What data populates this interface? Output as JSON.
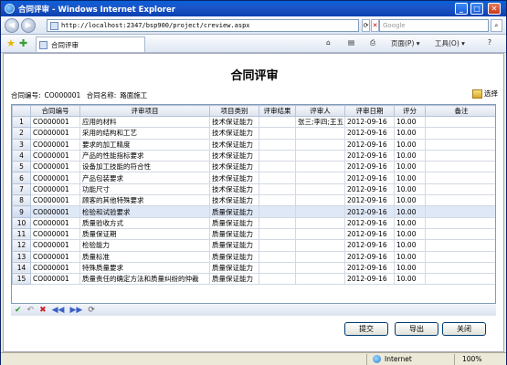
{
  "window": {
    "title": "合同评审 - Windows Internet Explorer",
    "minimize": "_",
    "maximize": "□",
    "close": "✕"
  },
  "browser": {
    "back": "◀",
    "forward": "▶",
    "url": "http://localhost:2347/bsp900/project/creview.aspx",
    "refresh": "⟳",
    "stop": "✕",
    "search_placeholder": "Google",
    "tab_title": "合同评审",
    "home": "⌂",
    "feeds": "▤",
    "print": "⎙",
    "page_menu": "页面(P) ▾",
    "tools_menu": "工具(O) ▾",
    "help": "?"
  },
  "page": {
    "title": "合同评审",
    "contract_no_label": "合同编号:",
    "contract_no": "CO000001",
    "contract_name_label": "合同名称:",
    "contract_name": "路面施工",
    "select_label": "选择"
  },
  "grid": {
    "columns": [
      "",
      "合同编号",
      "评审项目",
      "项目类别",
      "评审结果",
      "评审人",
      "评审日期",
      "评分",
      "备注"
    ],
    "rows": [
      {
        "n": "1",
        "no": "CO000001",
        "item": "应用的材料",
        "cat": "技术保证能力",
        "result": "",
        "reviewer": "张三;李四;王五",
        "date": "2012-09-16",
        "score": "10.00",
        "note": ""
      },
      {
        "n": "2",
        "no": "CO000001",
        "item": "采用的结构和工艺",
        "cat": "技术保证能力",
        "result": "",
        "reviewer": "",
        "date": "2012-09-16",
        "score": "10.00",
        "note": ""
      },
      {
        "n": "3",
        "no": "CO000001",
        "item": "要求的加工精度",
        "cat": "技术保证能力",
        "result": "",
        "reviewer": "",
        "date": "2012-09-16",
        "score": "10.00",
        "note": ""
      },
      {
        "n": "4",
        "no": "CO000001",
        "item": "产品的性能指标要求",
        "cat": "技术保证能力",
        "result": "",
        "reviewer": "",
        "date": "2012-09-16",
        "score": "10.00",
        "note": ""
      },
      {
        "n": "5",
        "no": "CO000001",
        "item": "设备加工技能的符合性",
        "cat": "技术保证能力",
        "result": "",
        "reviewer": "",
        "date": "2012-09-16",
        "score": "10.00",
        "note": ""
      },
      {
        "n": "6",
        "no": "CO000001",
        "item": "产品包装要求",
        "cat": "技术保证能力",
        "result": "",
        "reviewer": "",
        "date": "2012-09-16",
        "score": "10.00",
        "note": ""
      },
      {
        "n": "7",
        "no": "CO000001",
        "item": "功能尺寸",
        "cat": "技术保证能力",
        "result": "",
        "reviewer": "",
        "date": "2012-09-16",
        "score": "10.00",
        "note": ""
      },
      {
        "n": "8",
        "no": "CO000001",
        "item": "顾客的其他特殊要求",
        "cat": "技术保证能力",
        "result": "",
        "reviewer": "",
        "date": "2012-09-16",
        "score": "10.00",
        "note": ""
      },
      {
        "n": "9",
        "no": "CO000001",
        "item": "检验和试验要求",
        "cat": "质量保证能力",
        "result": "",
        "reviewer": "",
        "date": "2012-09-16",
        "score": "10.00",
        "note": ""
      },
      {
        "n": "10",
        "no": "CO000001",
        "item": "质量验收方式",
        "cat": "质量保证能力",
        "result": "",
        "reviewer": "",
        "date": "2012-09-16",
        "score": "10.00",
        "note": ""
      },
      {
        "n": "11",
        "no": "CO000001",
        "item": "质量保证期",
        "cat": "质量保证能力",
        "result": "",
        "reviewer": "",
        "date": "2012-09-16",
        "score": "10.00",
        "note": ""
      },
      {
        "n": "12",
        "no": "CO000001",
        "item": "检验能力",
        "cat": "质量保证能力",
        "result": "",
        "reviewer": "",
        "date": "2012-09-16",
        "score": "10.00",
        "note": ""
      },
      {
        "n": "13",
        "no": "CO000001",
        "item": "质量标准",
        "cat": "质量保证能力",
        "result": "",
        "reviewer": "",
        "date": "2012-09-16",
        "score": "10.00",
        "note": ""
      },
      {
        "n": "14",
        "no": "CO000001",
        "item": "特殊质量要求",
        "cat": "质量保证能力",
        "result": "",
        "reviewer": "",
        "date": "2012-09-16",
        "score": "10.00",
        "note": ""
      },
      {
        "n": "15",
        "no": "CO000001",
        "item": "质量责任的确定方法和质量纠纷的仲裁",
        "cat": "质量保证能力",
        "result": "",
        "reviewer": "",
        "date": "2012-09-16",
        "score": "10.00",
        "note": ""
      }
    ],
    "highlight_row": 9,
    "toolbar": [
      "✔",
      "↶",
      "✖",
      "◀◀",
      "▶▶",
      "⟳"
    ]
  },
  "buttons": {
    "submit": "提交",
    "export": "导出",
    "close": "关闭"
  },
  "status": {
    "zone": "Internet",
    "zoom": "100%"
  },
  "colors": {
    "title_bar": "#0a40b0",
    "grid_header": "#dde4ef",
    "highlight": "#dfe8f6"
  }
}
